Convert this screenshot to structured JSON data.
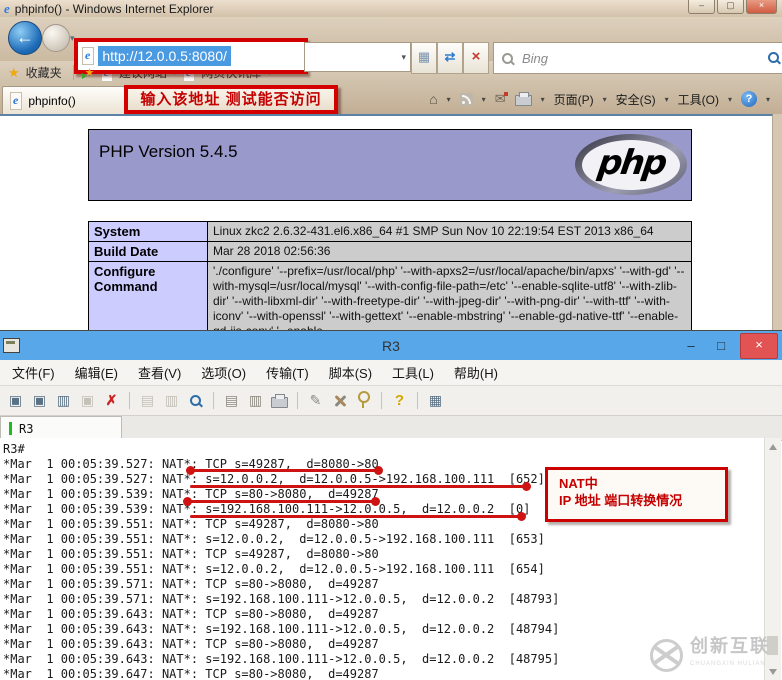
{
  "colors": {
    "annotation_red": "#d40000",
    "terminal_titlebar_blue": "#57a7e9",
    "php_header_purple": "#9999cc",
    "php_label_cell": "#ccccff",
    "php_value_cell": "#cccccc"
  },
  "icons": {
    "ie_logo": "e",
    "back_arrow": "←",
    "forward_arrow": "←",
    "caret": "▾",
    "compat": "▦",
    "refresh": "⇄",
    "stop": "×",
    "star": "★",
    "home": "⌂",
    "mail": "✉",
    "question": "?",
    "minimize": "–",
    "maximize": "▢",
    "close": "×",
    "terminal_minimize": "–",
    "terminal_maximize": "□",
    "terminal_close": "×"
  },
  "ie": {
    "window_title": "phpinfo() - Windows Internet Explorer",
    "address": {
      "url": "http://12.0.0.5:8080/"
    },
    "search": {
      "placeholder": "Bing"
    },
    "favorites_bar": {
      "favorites": "收藏夹",
      "suggested_sites": "建议网站",
      "web_slice_gallery": "网页快讯库"
    },
    "tab_label": "phpinfo()",
    "annotation": "输入该地址 测试能否访问",
    "command_bar": {
      "page": "页面(P)",
      "safety": "安全(S)",
      "tools": "工具(O)"
    }
  },
  "php": {
    "title": "PHP Version 5.4.5",
    "logo_text": "php",
    "rows": [
      [
        "System",
        "Linux zkc2 2.6.32-431.el6.x86_64 #1 SMP Sun Nov 10 22:19:54 EST 2013 x86_64"
      ],
      [
        "Build Date",
        "Mar 28 2018 02:56:36"
      ],
      [
        "Configure Command",
        "'./configure' '--prefix=/usr/local/php' '--with-apxs2=/usr/local/apache/bin/apxs' '--with-gd' '--with-mysql=/usr/local/mysql' '--with-config-file-path=/etc' '--enable-sqlite-utf8' '--with-zlib-dir' '--with-libxml-dir' '--with-freetype-dir' '--with-jpeg-dir' '--with-png-dir' '--with-ttf' '--with-iconv' '--with-openssl' '--with-gettext' '--enable-mbstring' '--enable-gd-native-ttf' '--enable-gd-jis-conv' '--enable-"
      ]
    ]
  },
  "terminal": {
    "title": "R3",
    "menus": [
      "文件(F)",
      "编辑(E)",
      "查看(V)",
      "选项(O)",
      "传输(T)",
      "脚本(S)",
      "工具(L)",
      "帮助(H)"
    ],
    "toolbar": [
      {
        "name": "quick-connect-icon",
        "glyph": "▣",
        "style": "c-steel"
      },
      {
        "name": "connect-icon",
        "glyph": "▣",
        "style": "c-steel"
      },
      {
        "name": "tabbed-session-icon",
        "glyph": "▥",
        "style": "c-steel"
      },
      {
        "name": "reconnect-icon",
        "glyph": "▣",
        "style": "c-gray"
      },
      {
        "name": "disconnect-icon",
        "glyph": "✗",
        "style": "c-red"
      },
      {
        "name": "sep"
      },
      {
        "name": "copy-icon",
        "glyph": "▤",
        "style": "c-gray"
      },
      {
        "name": "paste-icon",
        "glyph": "▥",
        "style": "c-gray"
      },
      {
        "name": "find-icon",
        "glyph": "mag"
      },
      {
        "name": "sep"
      },
      {
        "name": "print-preview-icon",
        "glyph": "▤",
        "style": "c-dim"
      },
      {
        "name": "print-selection-icon",
        "glyph": "▥",
        "style": "c-dim"
      },
      {
        "name": "print-icon",
        "glyph": "printer"
      },
      {
        "name": "sep"
      },
      {
        "name": "session-options-icon",
        "glyph": "✎",
        "style": "c-dim"
      },
      {
        "name": "global-options-icon",
        "glyph": "tools"
      },
      {
        "name": "keymap-icon",
        "glyph": "key"
      },
      {
        "name": "sep"
      },
      {
        "name": "help-icon",
        "glyph": "?",
        "style": "c-gold"
      },
      {
        "name": "sep"
      },
      {
        "name": "session-manager-icon",
        "glyph": "▦",
        "style": "c-steel"
      }
    ],
    "session_tab": "R3",
    "lines": [
      "R3#",
      "*Mar  1 00:05:39.527: NAT*: TCP s=49287,  d=8080->80",
      "*Mar  1 00:05:39.527: NAT*: s=12.0.0.2,  d=12.0.0.5->192.168.100.111  [652]",
      "*Mar  1 00:05:39.539: NAT*: TCP s=80->8080,  d=49287",
      "*Mar  1 00:05:39.539: NAT*: s=192.168.100.111->12.0.0.5,  d=12.0.0.2  [0]",
      "*Mar  1 00:05:39.551: NAT*: TCP s=49287,  d=8080->80",
      "*Mar  1 00:05:39.551: NAT*: s=12.0.0.2,  d=12.0.0.5->192.168.100.111  [653]",
      "*Mar  1 00:05:39.551: NAT*: TCP s=49287,  d=8080->80",
      "*Mar  1 00:05:39.551: NAT*: s=12.0.0.2,  d=12.0.0.5->192.168.100.111  [654]",
      "*Mar  1 00:05:39.571: NAT*: TCP s=80->8080,  d=49287",
      "*Mar  1 00:05:39.571: NAT*: s=192.168.100.111->12.0.0.5,  d=12.0.0.2  [48793]",
      "*Mar  1 00:05:39.643: NAT*: TCP s=80->8080,  d=49287",
      "*Mar  1 00:05:39.643: NAT*: s=192.168.100.111->12.0.0.5,  d=12.0.0.2  [48794]",
      "*Mar  1 00:05:39.643: NAT*: TCP s=80->8080,  d=49287",
      "*Mar  1 00:05:39.643: NAT*: s=192.168.100.111->12.0.0.5,  d=12.0.0.2  [48795]",
      "*Mar  1 00:05:39.647: NAT*: TCP s=80->8080,  d=49287"
    ],
    "annotation": {
      "line1": "NAT中",
      "line2": "IP 地址 端口转换情况"
    }
  },
  "watermark": {
    "brand": "创新互联",
    "caption": "CHUANGXIN HULIAN"
  }
}
